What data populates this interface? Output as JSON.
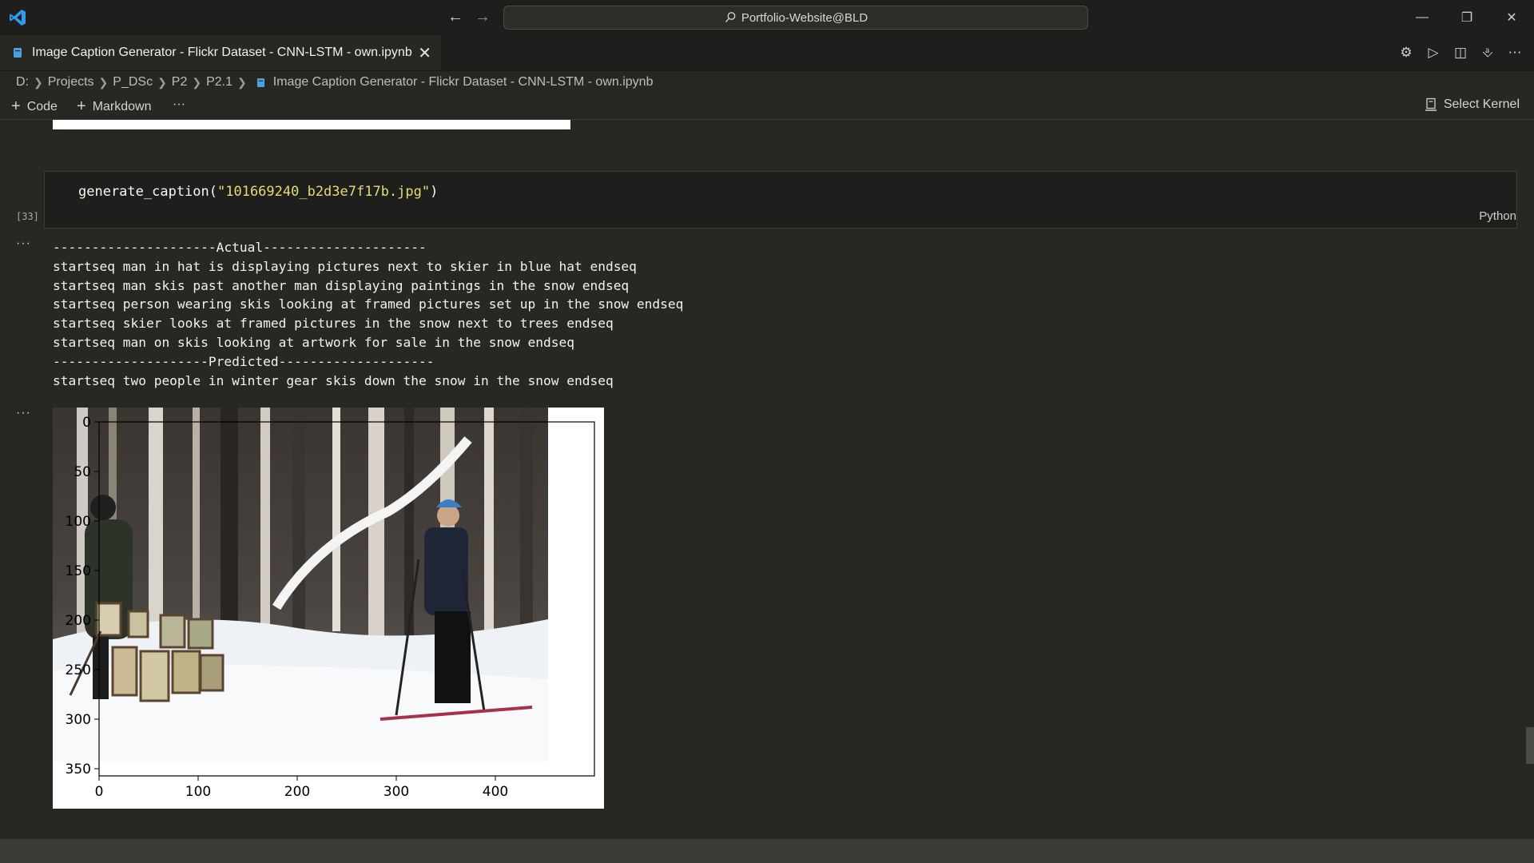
{
  "titlebar": {
    "search_text": "Portfolio-Website@BLD",
    "icons": [
      "vscode-logo-icon",
      "arrow-left-icon",
      "arrow-right-icon",
      "search-icon",
      "minimize-icon",
      "restore-icon",
      "close-icon"
    ]
  },
  "tab": {
    "label": "Image Caption Generator - Flickr Dataset - CNN-LSTM - own.ipynb"
  },
  "breadcrumb": {
    "items": [
      "D:",
      "Projects",
      "P_DSc",
      "P2",
      "P2.1",
      "Image Caption Generator - Flickr Dataset - CNN-LSTM - own.ipynb"
    ]
  },
  "toolbar": {
    "code_label": "Code",
    "markdown_label": "Markdown",
    "more_label": "···",
    "kernel_label": "Select Kernel"
  },
  "cell": {
    "code_fn": "generate_caption(",
    "code_arg": "\"101669240_b2d3e7f17b.jpg\"",
    "code_close": ")",
    "exec_count": "[33]",
    "language": "Python"
  },
  "output": {
    "dots": "···",
    "lines": [
      "---------------------Actual---------------------",
      "startseq man in hat is displaying pictures next to skier in blue hat endseq",
      "startseq man skis past another man displaying paintings in the snow endseq",
      "startseq person wearing skis looking at framed pictures set up in the snow endseq",
      "startseq skier looks at framed pictures in the snow next to trees endseq",
      "startseq man on skis looking at artwork for sale in the snow endseq",
      "--------------------Predicted--------------------",
      "startseq two people in winter gear skis down the snow in the snow endseq"
    ]
  },
  "figure": {
    "y_ticks": [
      "0",
      "50",
      "100",
      "150",
      "200",
      "250",
      "300",
      "350"
    ],
    "x_ticks": [
      "0",
      "100",
      "200",
      "300",
      "400"
    ]
  },
  "colors": {
    "background": "#272822",
    "cell_background": "#1e1f1c",
    "string": "#e6db74"
  }
}
